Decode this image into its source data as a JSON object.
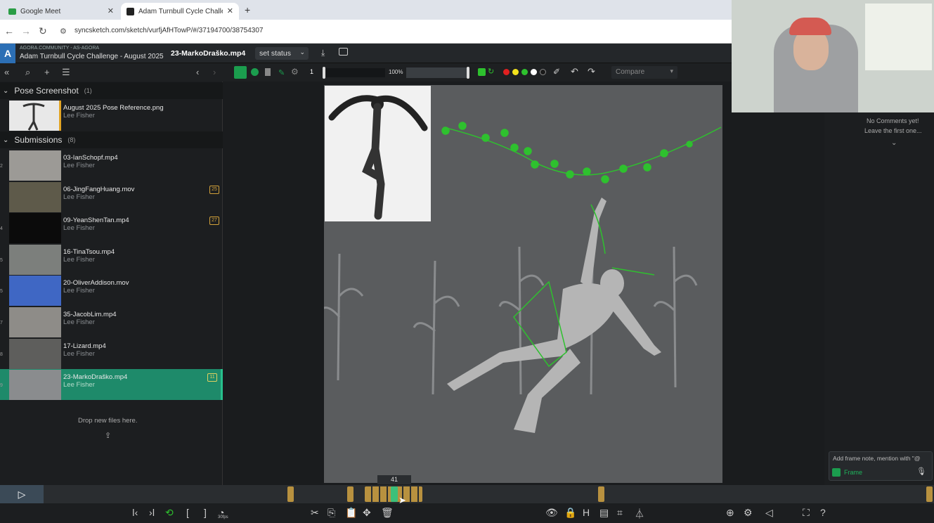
{
  "browser": {
    "tabs": [
      {
        "label": "Google Meet",
        "active": false
      },
      {
        "label": "Adam Turnbull Cycle Challenge",
        "active": true
      }
    ],
    "new_tab": "+",
    "close": "✕",
    "url": "syncsketch.com/sketch/vurfjAfHTowP/#/37194700/38754307"
  },
  "app": {
    "org_name": "AGORA.COMMUNITY - AS-AGORA",
    "project_title": "Adam Turnbull Cycle Challenge - August 2025",
    "current_file": "23-MarkoDraško.mp4",
    "status_label": "set status"
  },
  "toolbar": {
    "frame_input": "1",
    "zoom": "100%",
    "compare_label": "Compare",
    "colors": [
      "#e02020",
      "#f2e21c",
      "#2ec12e",
      "#ffffff",
      "#1a1a1a"
    ]
  },
  "sidebar": {
    "sections": [
      {
        "title": "Pose Screenshot",
        "count": "(1)"
      },
      {
        "title": "Submissions",
        "count": "(8)"
      }
    ],
    "pose_item": {
      "name": "August 2025 Pose Reference.png",
      "user": "Lee Fisher"
    },
    "items": [
      {
        "index": "2",
        "name": "03-IanSchopf.mp4",
        "user": "Lee Fisher",
        "badge": "",
        "thumb": "#9c9a96"
      },
      {
        "index": "",
        "name": "06-JingFangHuang.mov",
        "user": "Lee Fisher",
        "badge": "25",
        "thumb": "#5e5a4a"
      },
      {
        "index": "4",
        "name": "09-YeanShenTan.mp4",
        "user": "Lee Fisher",
        "badge": "27",
        "thumb": "#0b0b0b"
      },
      {
        "index": "5",
        "name": "16-TinaTsou.mp4",
        "user": "Lee Fisher",
        "badge": "",
        "thumb": "#7c7f7c"
      },
      {
        "index": "5",
        "name": "20-OliverAddison.mov",
        "user": "Lee Fisher",
        "badge": "",
        "thumb": "#3f67c4"
      },
      {
        "index": "7",
        "name": "35-JacobLim.mp4",
        "user": "Lee Fisher",
        "badge": "",
        "thumb": "#8e8c88"
      },
      {
        "index": "8",
        "name": "17-Lizard.mp4",
        "user": "Lee Fisher",
        "badge": "",
        "thumb": "#5e5e5c"
      },
      {
        "index": "9",
        "name": "23-MarkoDraško.mp4",
        "user": "Lee Fisher",
        "badge": "11",
        "thumb": "#8a8c8e",
        "selected": true
      }
    ],
    "drop_text": "Drop new files here."
  },
  "comments": {
    "empty_line1": "No Comments yet!",
    "empty_line2": "Leave the first one...",
    "input_placeholder": "Add frame note, mention with \"@",
    "frame_label": "Frame"
  },
  "timeline": {
    "current_frame": "41",
    "fps_label": "30fps"
  }
}
